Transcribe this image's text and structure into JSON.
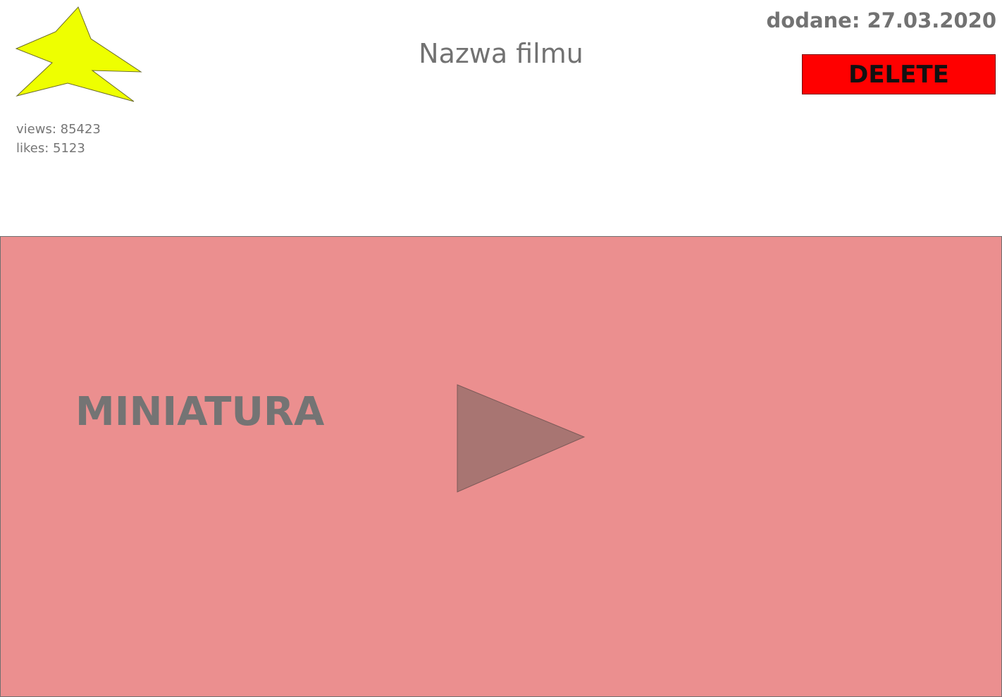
{
  "video": {
    "title": "Nazwa filmu",
    "added_label": "dodane: 27.03.2020",
    "views_label": "views: 85423",
    "likes_label": "likes: 5123",
    "delete_label": "DELETE",
    "thumbnail_label": "MINIATURA"
  },
  "colors": {
    "star": "#eeff00",
    "delete_button": "#ff0000",
    "thumbnail_bg": "#eb8f8f",
    "play_icon": "#a87572",
    "text": "#727272"
  },
  "icons": {
    "logo": "star-icon",
    "play": "play-icon"
  }
}
